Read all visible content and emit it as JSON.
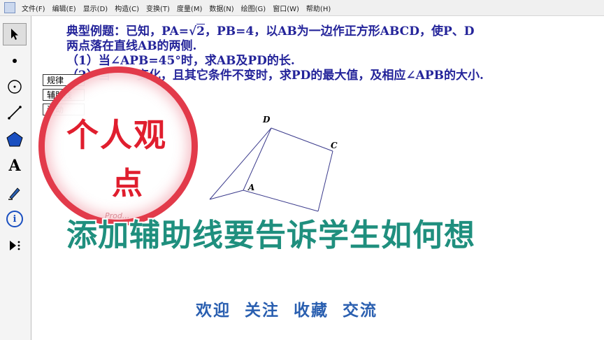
{
  "menu": [
    "文件(F)",
    "编辑(E)",
    "显示(D)",
    "构造(C)",
    "变换(T)",
    "度量(M)",
    "数据(N)",
    "绘图(G)",
    "窗口(W)",
    "帮助(H)"
  ],
  "toolbar": {
    "tools": [
      "arrow-tool",
      "point-tool",
      "compass-tool",
      "straightedge-tool",
      "polygon-tool",
      "text-tool",
      "marker-tool",
      "info-tool",
      "custom-tool"
    ],
    "text_tool_label": "A",
    "info_tool_label": "i"
  },
  "problem": {
    "line1_pre": "典型例题：已知，PA=",
    "line1_sqrt": "2",
    "line1_post": "，PB=4，以AB为一边作正方形ABCD，使P、D",
    "line2": "两点落在直线AB的两侧.",
    "line3": "（1）当∠APB=45°时，求AB及PD的长.",
    "line4_a": "（2）当",
    "line4_b": "变化，且其它条件不变时，求PD的最大值，及相应∠APB的大小."
  },
  "side_buttons": [
    "规律",
    "辅助线",
    "波动"
  ],
  "figure": {
    "labels": {
      "D": "D",
      "C": "C",
      "A": "A"
    }
  },
  "watermark": {
    "line1": "个人观",
    "line2": "点",
    "small": "Prod..."
  },
  "caption": "添加辅助线要告诉学生如何想",
  "footer": "欢迎 关注 收藏  交流",
  "colors": {
    "problem_text": "#24249a",
    "caption": "#1f8f7e",
    "footer": "#2a5fb0",
    "watermark": "#e01e2e"
  }
}
